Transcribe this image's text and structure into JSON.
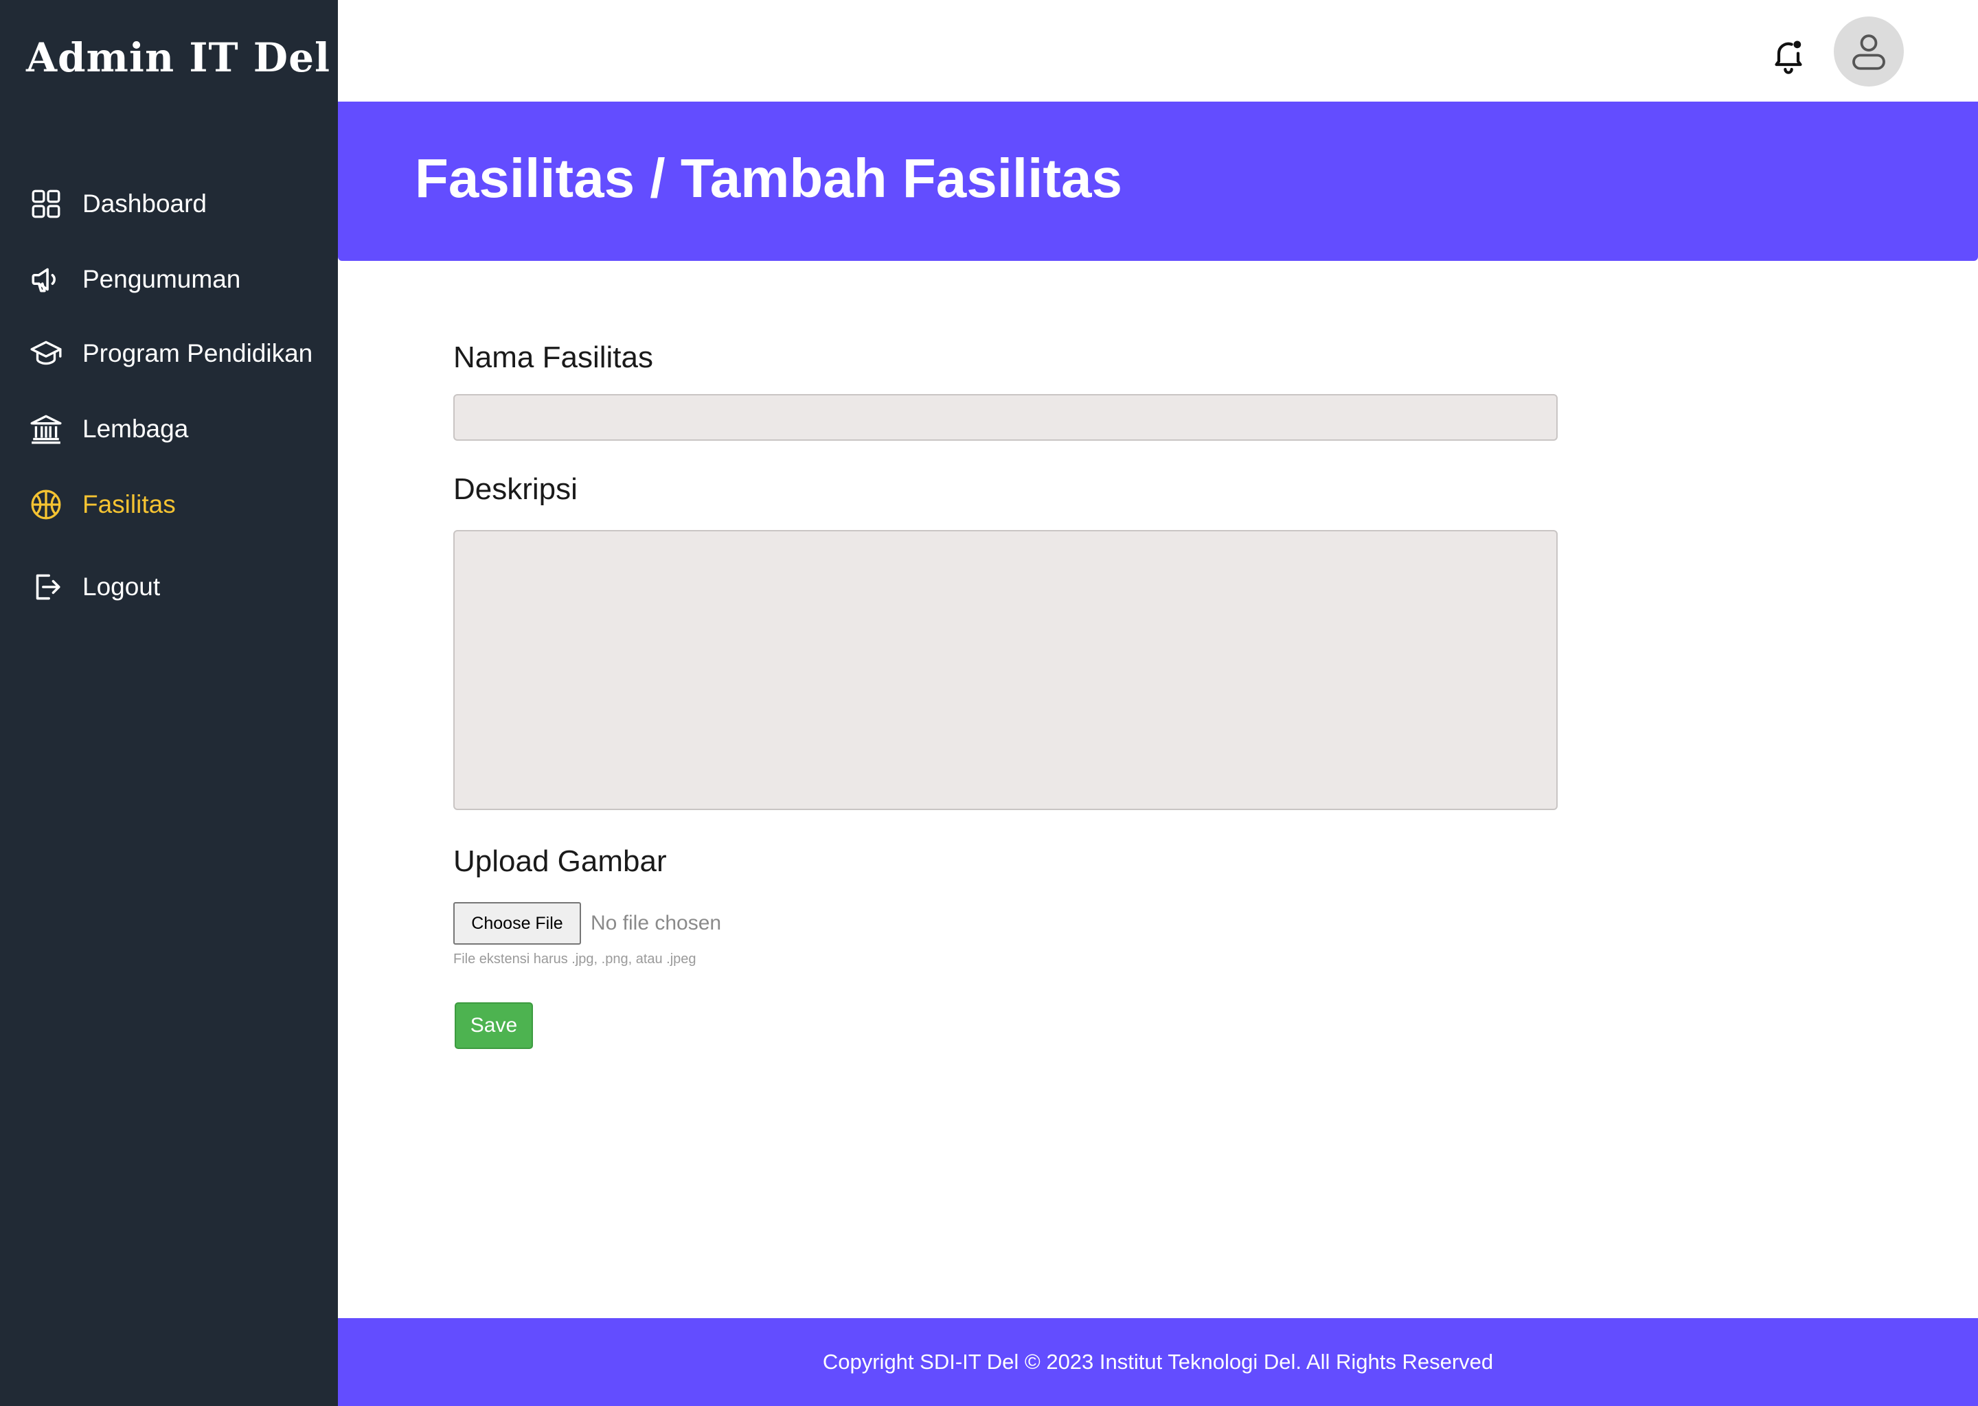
{
  "app": {
    "brand": "Admin IT Del"
  },
  "sidebar": {
    "items": [
      {
        "label": "Dashboard",
        "icon": "grid-icon",
        "active": false
      },
      {
        "label": "Pengumuman",
        "icon": "megaphone-icon",
        "active": false
      },
      {
        "label": "Program Pendidikan",
        "icon": "graduation-cap-icon",
        "active": false
      },
      {
        "label": "Lembaga",
        "icon": "institution-icon",
        "active": false
      },
      {
        "label": "Fasilitas",
        "icon": "basketball-icon",
        "active": true
      },
      {
        "label": "Logout",
        "icon": "logout-icon",
        "active": false
      }
    ]
  },
  "header": {
    "notification_icon": "bell-icon",
    "avatar_icon": "user-icon"
  },
  "banner": {
    "title": "Fasilitas / Tambah Fasilitas"
  },
  "form": {
    "name_label": "Nama Fasilitas",
    "name_value": "",
    "description_label": "Deskripsi",
    "description_value": "",
    "upload_label": "Upload Gambar",
    "choose_file_label": "Choose File",
    "file_status": "No file chosen",
    "file_hint": "File ekstensi harus .jpg, .png, atau .jpeg",
    "save_label": "Save"
  },
  "footer": {
    "text": "Copyright SDI-IT Del © 2023 Institut Teknologi Del. All Rights Reserved"
  },
  "colors": {
    "sidebar_bg": "#212a35",
    "accent": "#634dff",
    "active_nav": "#f5c332",
    "save_button": "#4db350",
    "input_bg": "#ece8e7"
  }
}
